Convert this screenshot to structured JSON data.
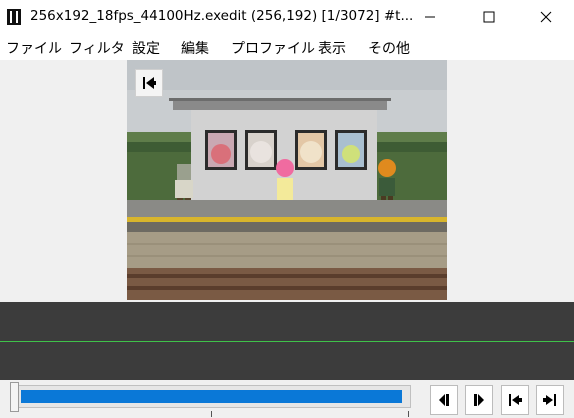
{
  "window": {
    "title": "256x192_18fps_44100Hz.exedit (256,192)  [1/3072]  #t...",
    "icon": "film-icon"
  },
  "menu": [
    "ファイル",
    "フィルタ",
    "設定",
    "編集",
    "プロファイル",
    "表示",
    "その他"
  ],
  "window_buttons": [
    "minimize-icon",
    "maximize-icon",
    "close-icon"
  ],
  "preview": {
    "back_icon": "jump-to-start-icon"
  },
  "playback": {
    "progress_fraction": 0.99
  },
  "controls": [
    "prev-frame-icon",
    "next-frame-icon",
    "jump-to-start-icon",
    "jump-to-end-icon"
  ],
  "colors": {
    "accent": "#0a78d7",
    "timeline_bg": "#3c3c3c",
    "track_line": "#3fc24a"
  }
}
